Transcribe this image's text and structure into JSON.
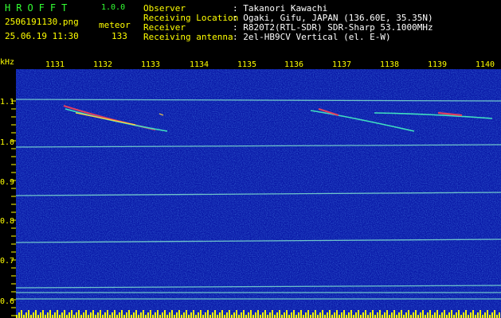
{
  "header": {
    "logo": "HROFFT",
    "version": "1.0.0",
    "filename": "2506191130.png",
    "mode": "meteor",
    "datetime": "25.06.19 11:30",
    "count": "133"
  },
  "info": {
    "rows": [
      {
        "label": "Observer",
        "value": ": Takanori Kawachi"
      },
      {
        "label": "Receiving Location",
        "value": ": Ogaki, Gifu, JAPAN (136.60E, 35.35N)"
      },
      {
        "label": "Receiver",
        "value": ": R820T2(RTL-SDR) SDR-Sharp 53.1000MHz"
      },
      {
        "label": "Receiving antenna",
        "value": ": 2el-HB9CV Vertical (el. E-W)"
      }
    ]
  },
  "axes": {
    "y_unit": "kHz",
    "y_ticks": [
      "1.1",
      "1.0",
      "0.9",
      "0.8",
      "0.7",
      "0.6"
    ],
    "x_ticks": [
      "1131",
      "1132",
      "1133",
      "1134",
      "1135",
      "1136",
      "1137",
      "1138",
      "1139",
      "1140"
    ]
  },
  "colors": {
    "background": "#000000",
    "spectrogram_base": "#0a1aa8",
    "label_yellow": "#ffff00",
    "logo_green": "#33ff33",
    "trace_cyan": "#40e0c0"
  }
}
